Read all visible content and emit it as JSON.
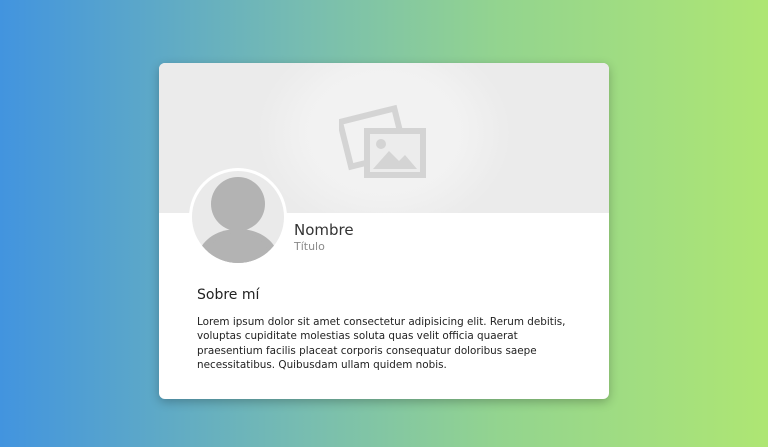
{
  "profile": {
    "name": "Nombre",
    "title": "Título"
  },
  "about": {
    "heading": "Sobre mí",
    "text": "Lorem ipsum dolor sit amet consectetur adipisicing elit. Rerum debitis, voluptas cupiditate molestias soluta quas velit officia quaerat praesentium facilis placeat corporis consequatur doloribus saepe necessitatibus. Quibusdam ullam quidem nobis."
  },
  "icons": {
    "cover": "image-placeholder-icon",
    "avatar": "user-silhouette-icon"
  },
  "colors": {
    "background_start": "#4294df",
    "background_end": "#aee673",
    "card": "#ffffff",
    "cover": "#ebebeb",
    "placeholder_icon": "#d4d4d4",
    "avatar_silhouette": "#b3b3b3"
  }
}
